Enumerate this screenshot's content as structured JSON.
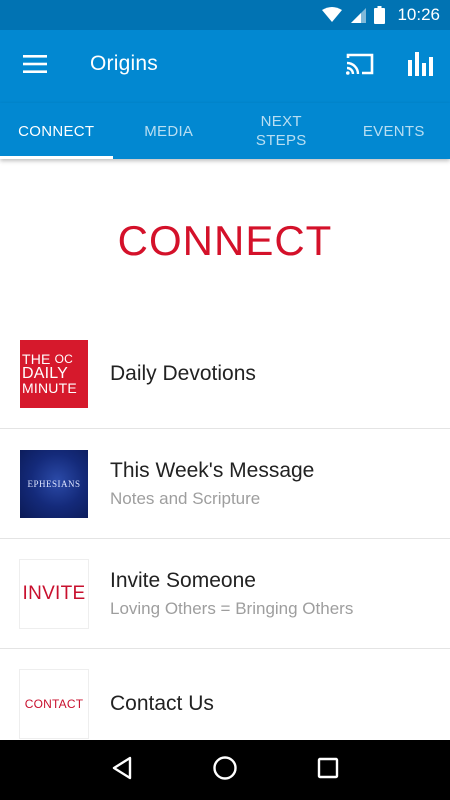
{
  "status_bar": {
    "time": "10:26",
    "icons": [
      "wifi-icon",
      "cell-signal-icon",
      "battery-icon"
    ]
  },
  "app_bar": {
    "title": "Origins",
    "icons": [
      "menu-icon",
      "cast-icon",
      "bar-chart-icon"
    ]
  },
  "tabs": [
    {
      "label": "CONNECT",
      "active": true
    },
    {
      "label": "MEDIA",
      "active": false
    },
    {
      "label": "NEXT\nSTEPS",
      "active": false
    },
    {
      "label": "EVENTS",
      "active": false
    }
  ],
  "hero": {
    "title": "CONNECT"
  },
  "items": [
    {
      "title": "Daily Devotions",
      "subtitle": "",
      "thumb": {
        "line1": "THE",
        "line1b": "OC",
        "line2": "DAILY",
        "line3": "MINUTE"
      }
    },
    {
      "title": "This Week's Message",
      "subtitle": "Notes and Scripture",
      "thumb": {
        "text": "EPHESIANS"
      }
    },
    {
      "title": "Invite Someone",
      "subtitle": "Loving Others = Bringing Others",
      "thumb": {
        "text": "INVITE"
      }
    },
    {
      "title": "Contact Us",
      "subtitle": "",
      "thumb": {
        "text": "CONTACT"
      }
    }
  ],
  "colors": {
    "primary": "#0288d1",
    "status_bar": "#0173b3",
    "accent_red": "#d4112a"
  },
  "nav_bar": {
    "icons": [
      "back-icon",
      "home-icon",
      "recents-icon"
    ]
  }
}
